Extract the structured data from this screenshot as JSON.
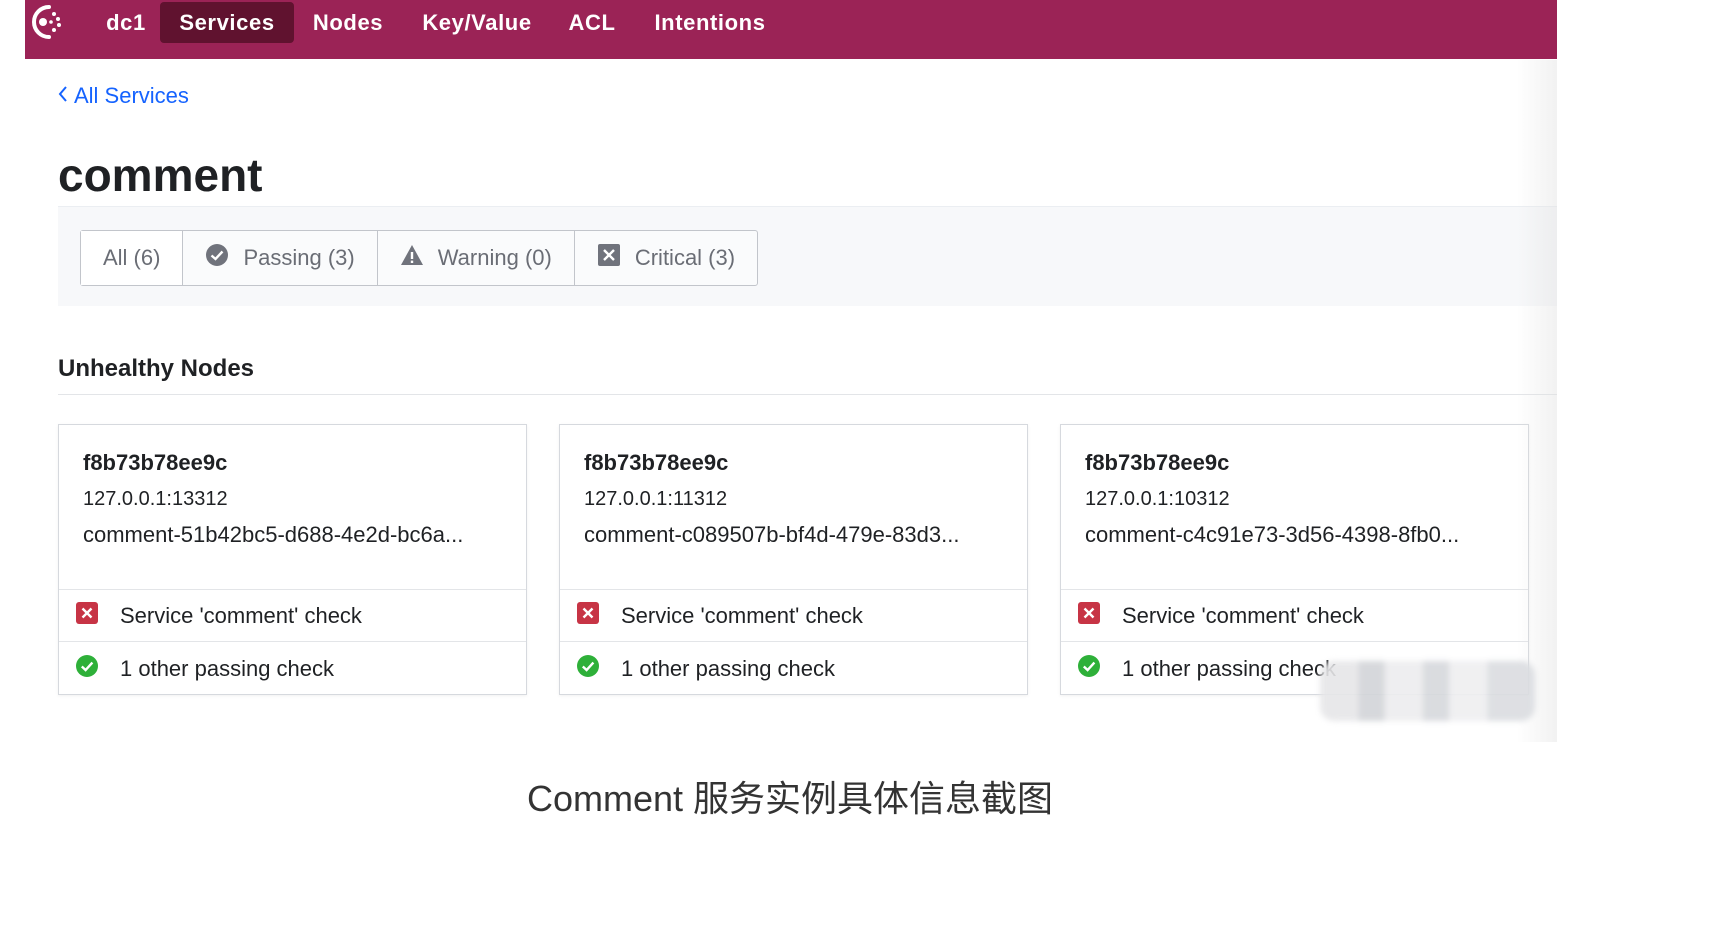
{
  "nav": {
    "datacenter": "dc1",
    "items": [
      {
        "label": "Services",
        "active": true
      },
      {
        "label": "Nodes"
      },
      {
        "label": "Key/Value"
      },
      {
        "label": "ACL"
      },
      {
        "label": "Intentions"
      }
    ]
  },
  "breadcrumb": {
    "label": "All Services"
  },
  "page": {
    "title": "comment"
  },
  "filters": {
    "all": "All (6)",
    "passing": "Passing (3)",
    "warning": "Warning (0)",
    "critical": "Critical (3)"
  },
  "section": {
    "title": "Unhealthy Nodes"
  },
  "nodes": [
    {
      "name": "f8b73b78ee9c",
      "address": "127.0.0.1:13312",
      "service_id": "comment-51b42bc5-d688-4e2d-bc6a...",
      "failing_check": "Service 'comment' check",
      "passing_summary": "1 other passing check"
    },
    {
      "name": "f8b73b78ee9c",
      "address": "127.0.0.1:11312",
      "service_id": "comment-c089507b-bf4d-479e-83d3...",
      "failing_check": "Service 'comment' check",
      "passing_summary": "1 other passing check"
    },
    {
      "name": "f8b73b78ee9c",
      "address": "127.0.0.1:10312",
      "service_id": "comment-c4c91e73-3d56-4398-8fb0...",
      "failing_check": "Service 'comment' check",
      "passing_summary": "1 other passing check"
    }
  ],
  "caption": "Comment 服务实例具体信息截图",
  "colors": {
    "nav_bg": "#9b2356",
    "nav_active": "#60122f",
    "link": "#1563ff",
    "critical": "#c73445",
    "passing": "#2eb039"
  },
  "icons": {
    "logo": "consul-logo-icon",
    "back": "chevron-left-icon",
    "passing": "check-circle-icon",
    "warning": "warning-triangle-icon",
    "critical": "x-square-icon"
  }
}
